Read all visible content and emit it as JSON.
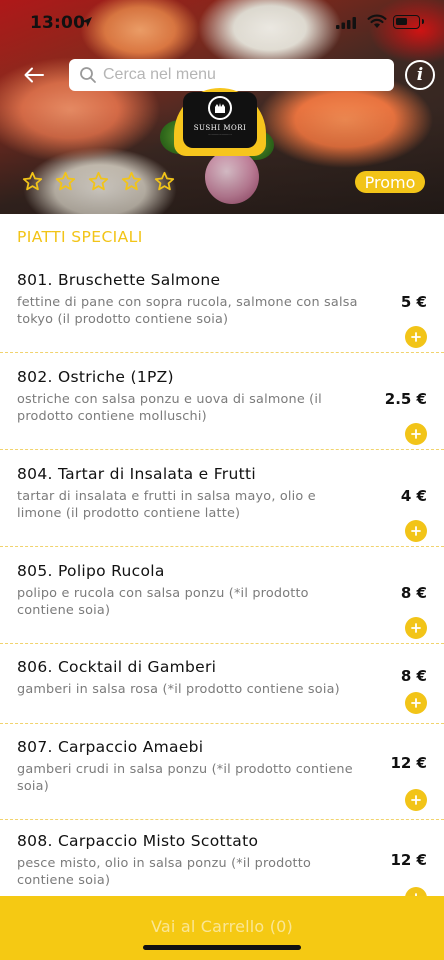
{
  "status_bar": {
    "time": "13:00"
  },
  "header": {
    "search_placeholder": "Cerca nel menu",
    "info_glyph": "i",
    "logo_name": "SUSHI MORI",
    "promo_label": "Promo",
    "rating_stars": 5,
    "rating_filled": 0
  },
  "section": {
    "title": "PIATTI SPECIALI"
  },
  "items": [
    {
      "name": "801. Bruschette Salmone",
      "description": "fettine di pane con sopra rucola, salmone con salsa tokyo (il prodotto contiene soia)",
      "price": "5 €"
    },
    {
      "name": "802. Ostriche (1PZ)",
      "description": "ostriche con salsa ponzu e uova di salmone (il prodotto contiene molluschi)",
      "price": "2.5 €"
    },
    {
      "name": "804. Tartar di Insalata e Frutti",
      "description": "tartar di insalata e frutti in salsa mayo, olio e limone (il prodotto contiene latte)",
      "price": "4 €"
    },
    {
      "name": "805. Polipo Rucola",
      "description": "polipo e rucola con salsa ponzu (*il prodotto contiene soia)",
      "price": "8 €"
    },
    {
      "name": "806. Cocktail di Gamberi",
      "description": "gamberi in salsa rosa (*il prodotto contiene soia)",
      "price": "8 €"
    },
    {
      "name": "807. Carpaccio Amaebi",
      "description": "gamberi crudi in salsa ponzu (*il prodotto contiene soia)",
      "price": "12 €"
    },
    {
      "name": "808. Carpaccio Misto Scottato",
      "description": "pesce misto, olio in salsa ponzu (*il prodotto contiene soia)",
      "price": "12 €"
    }
  ],
  "cart": {
    "label": "Vai al Carrello (0)"
  },
  "colors": {
    "accent": "#f2c418",
    "cart_bar": "#f5c913",
    "divider": "#f1d36d",
    "text": "#111111",
    "muted": "#7b7b7b"
  },
  "icons": [
    "back-arrow-icon",
    "search-icon",
    "info-icon",
    "star-icon",
    "plus-icon",
    "location-arrow-icon",
    "signal-icon",
    "wifi-icon",
    "battery-icon"
  ]
}
